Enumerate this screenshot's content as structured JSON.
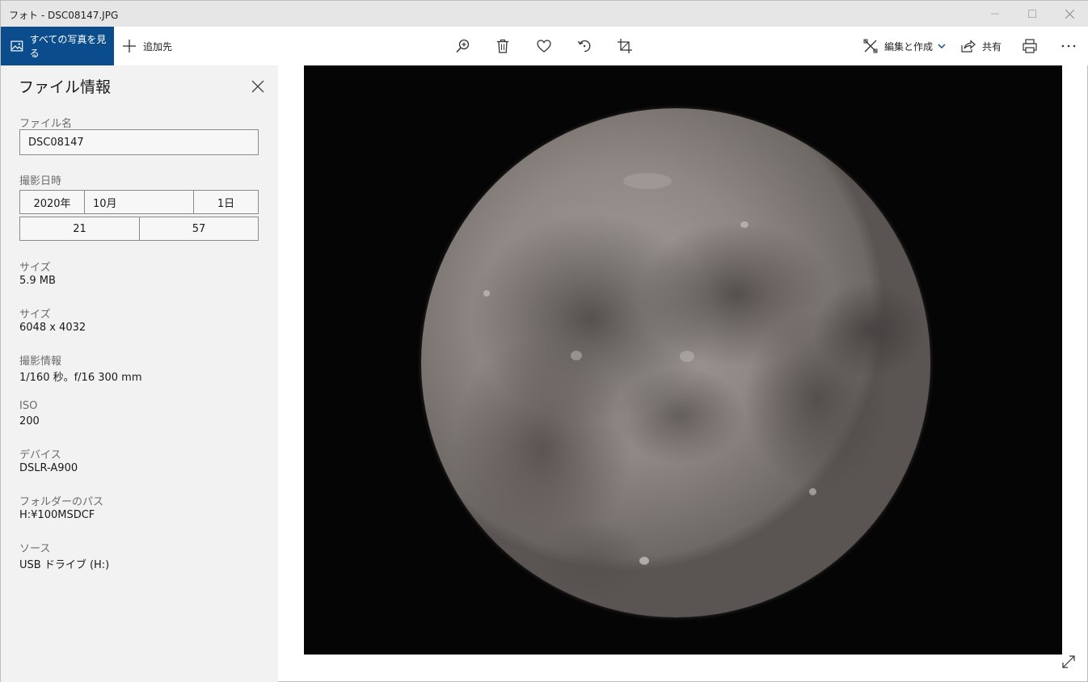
{
  "window": {
    "title": "フォト - DSC08147.JPG",
    "controls": [
      "minimize-icon",
      "maximize-icon",
      "close-icon"
    ]
  },
  "toolbar": {
    "all_photos_label": "すべての写真を見る",
    "add_to_label": "追加先",
    "zoom_icon": "zoom-in-icon",
    "delete_icon": "trash-icon",
    "favorite_icon": "heart-icon",
    "rotate_icon": "rotate-icon",
    "crop_icon": "crop-icon",
    "edit_create_label": "編集と作成",
    "share_label": "共有",
    "print_icon": "printer-icon",
    "more_icon": "more-icon",
    "accent_color": "#0b4c8c"
  },
  "file_info": {
    "heading": "ファイル情報",
    "file_name_label": "ファイル名",
    "file_name_value": "DSC08147",
    "date_taken_label": "撮影日時",
    "date": {
      "year": "2020年",
      "month": "10月",
      "day": "1日"
    },
    "time": {
      "hour": "21",
      "minute": "57"
    },
    "size_label": "サイズ",
    "size_value": "5.9 MB",
    "dimensions_label": "サイズ",
    "dimensions_value": "6048 x 4032",
    "camera_info_label": "撮影情報",
    "camera_info_value": "1/160 秒。f/16 300 mm",
    "iso_label": "ISO",
    "iso_value": "200",
    "device_label": "デバイス",
    "device_value": "DSLR-A900",
    "folder_label": "フォルダーのパス",
    "folder_value": "H:¥100MSDCF",
    "source_label": "ソース",
    "source_value": "USB ドライブ (H:)"
  }
}
